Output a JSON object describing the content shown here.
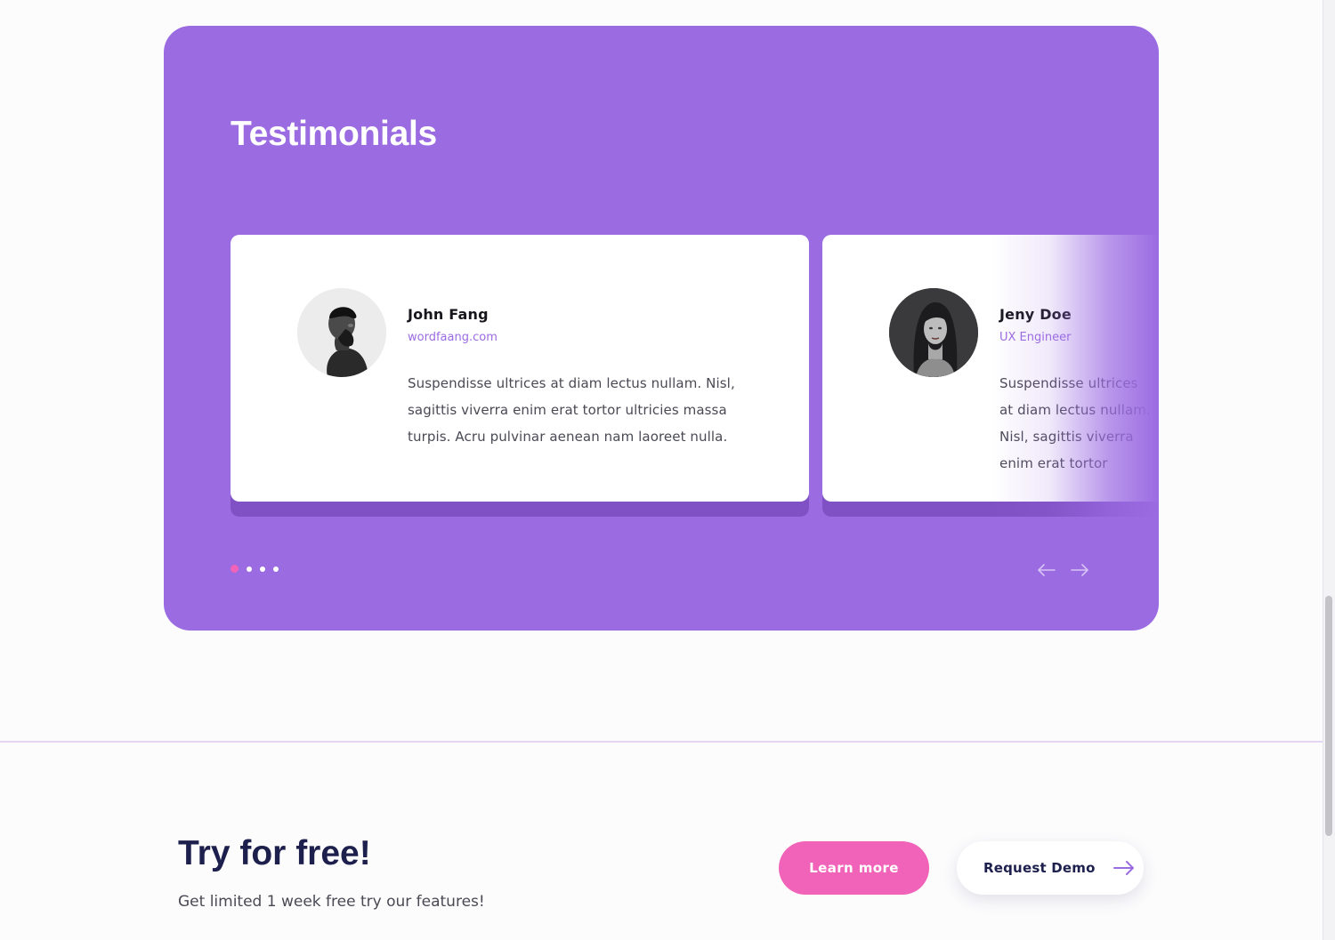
{
  "testimonials": {
    "title": "Testimonials",
    "cards": [
      {
        "name": "John Fang",
        "role": "wordfaang.com",
        "quote": "Suspendisse ultrices at diam lectus nullam. Nisl, sagittis viverra enim erat tortor ultricies massa turpis. Acru pulvinar aenean nam laoreet nulla."
      },
      {
        "name": "Jeny Doe",
        "role": "UX Engineer",
        "quote": "Suspendisse ultrices at diam lectus nullam. Nisl, sagittis viverra enim erat tortor"
      }
    ],
    "pagination": {
      "total": 4,
      "active": 1
    },
    "icons": {
      "prev": "arrow-left-icon",
      "next": "arrow-right-icon"
    }
  },
  "cta": {
    "title": "Try for free!",
    "subtitle": "Get limited 1 week free try our features!",
    "learn_more_label": "Learn more",
    "request_demo_label": "Request Demo",
    "request_demo_icon": "arrow-right-icon"
  },
  "colors": {
    "panel": "#9b6be2",
    "accent_pink": "#f063b8",
    "heading_navy": "#1d1f4d"
  }
}
